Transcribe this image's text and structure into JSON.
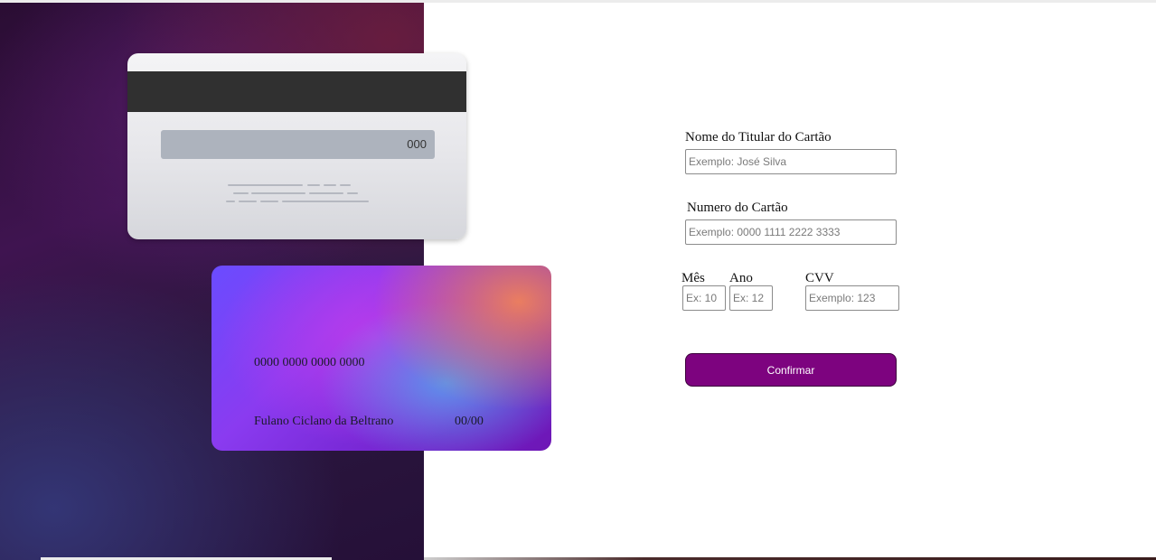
{
  "card_back": {
    "cvv": "000"
  },
  "card_front": {
    "number": "0000 0000 0000 0000",
    "holder": "Fulano Ciclano da Beltrano",
    "expiry": "00/00"
  },
  "form": {
    "name_label": "Nome do Titular do Cartão",
    "name_placeholder": "Exemplo: José Silva",
    "number_label": "Numero do Cartão",
    "number_placeholder": "Exemplo: 0000 1111 2222 3333",
    "month_label": "Mês",
    "month_placeholder": "Ex: 10",
    "year_label": "Ano",
    "year_placeholder": "Ex: 12",
    "cvv_label": "CVV",
    "cvv_placeholder": "Exemplo: 123",
    "confirm_label": "Confirmar"
  },
  "colors": {
    "button_bg": "#7d037f",
    "button_text": "#ffffff",
    "mag_stripe": "#303030"
  }
}
